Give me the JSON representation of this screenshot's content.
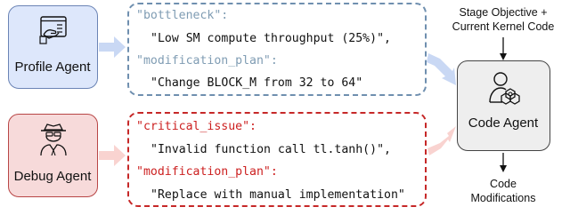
{
  "profile_agent": {
    "label": "Profile Agent",
    "icon": "chart-hand-icon",
    "fill": "#dde7fb",
    "border": "#6b84b5",
    "output": {
      "border_color": "#6f8faf",
      "key1": "\"bottleneck\":",
      "val1": "\"Low SM compute throughput (25%)\",",
      "key2": "\"modification_plan\":",
      "val2": "\"Change BLOCK_M from 32 to 64\""
    }
  },
  "debug_agent": {
    "label": "Debug Agent",
    "icon": "spy-agent-icon",
    "fill": "#f7dada",
    "border": "#b84646",
    "output": {
      "border_color": "#c62828",
      "key1": "\"critical_issue\":",
      "val1": "\"Invalid function call tl.tanh()\",",
      "key2": "\"modification_plan\":",
      "val2": "\"Replace with manual implementation\""
    }
  },
  "code_agent": {
    "label": "Code Agent",
    "icon": "user-gear-icon",
    "fill": "#eeeeee",
    "border": "#444444"
  },
  "inputs_label": [
    "Stage Objective +",
    "Current Kernel Code"
  ],
  "outputs_label": [
    "Code",
    "Modifications"
  ],
  "colors": {
    "blue_arrow": "#c9d8f4",
    "red_arrow": "#f9d3d0"
  }
}
